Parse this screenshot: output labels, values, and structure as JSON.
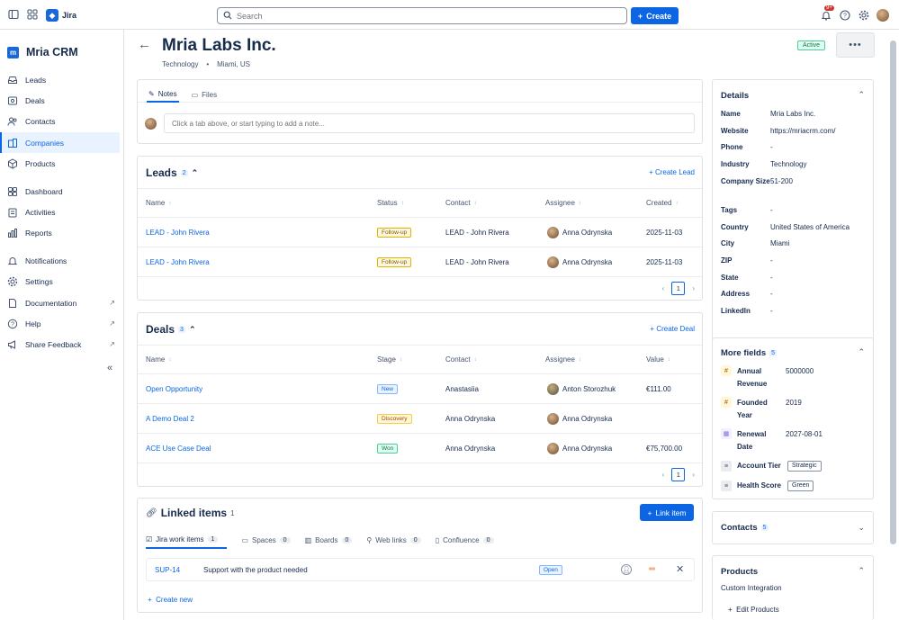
{
  "topbar": {
    "app_name": "Jira",
    "search_placeholder": "Search",
    "create_label": "Create",
    "notif_count": "9+"
  },
  "sidebar": {
    "brand": "Mria CRM",
    "items": [
      {
        "label": "Leads",
        "icon": "inbox-icon"
      },
      {
        "label": "Deals",
        "icon": "deals-icon"
      },
      {
        "label": "Contacts",
        "icon": "contacts-icon"
      },
      {
        "label": "Companies",
        "icon": "companies-icon"
      },
      {
        "label": "Products",
        "icon": "box-icon"
      },
      {
        "label": "Dashboard",
        "icon": "dashboard-icon"
      },
      {
        "label": "Activities",
        "icon": "activities-icon"
      },
      {
        "label": "Reports",
        "icon": "reports-icon"
      },
      {
        "label": "Notifications",
        "icon": "bell-icon"
      },
      {
        "label": "Settings",
        "icon": "gear-icon"
      },
      {
        "label": "Documentation",
        "icon": "doc-icon"
      },
      {
        "label": "Help",
        "icon": "help-icon"
      },
      {
        "label": "Share Feedback",
        "icon": "megaphone-icon"
      }
    ],
    "active": "Companies"
  },
  "header": {
    "title": "Mria Labs Inc.",
    "industry": "Technology",
    "separator": "•",
    "location": "Miami, US",
    "status": "Active"
  },
  "notes": {
    "tabs": [
      "Notes",
      "Files"
    ],
    "placeholder": "Click a tab above, or start typing to add a note..."
  },
  "leads": {
    "title": "Leads",
    "count": "2",
    "action": "Create Lead",
    "columns": [
      "Name",
      "Status",
      "Contact",
      "Assignee",
      "Created"
    ],
    "rows": [
      {
        "name": "LEAD - John Rivera",
        "status": "Follow-up",
        "contact": "LEAD - John Rivera",
        "assignee": "Anna Odrynska",
        "created": "2025-11-03"
      },
      {
        "name": "LEAD - John Rivera",
        "status": "Follow-up",
        "contact": "LEAD - John Rivera",
        "assignee": "Anna Odrynska",
        "created": "2025-11-03"
      }
    ],
    "page": "1"
  },
  "deals": {
    "title": "Deals",
    "count": "3",
    "action": "Create Deal",
    "columns": [
      "Name",
      "Stage",
      "Contact",
      "Assignee",
      "Value"
    ],
    "rows": [
      {
        "name": "Open Opportunity",
        "stage": "New",
        "contact": "Anastasiia",
        "assignee": "Anton Storozhuk",
        "value": "€111.00"
      },
      {
        "name": "A Demo Deal 2",
        "stage": "Discovery",
        "contact": "Anna Odrynska",
        "assignee": "Anna Odrynska",
        "value": ""
      },
      {
        "name": "ACE Use Case Deal",
        "stage": "Won",
        "contact": "Anna Odrynska",
        "assignee": "Anna Odrynska",
        "value": "€75,700.00"
      }
    ],
    "page": "1"
  },
  "linked": {
    "title": "Linked items",
    "count": "1",
    "action": "Link item",
    "tabs": [
      {
        "label": "Jira work items",
        "count": "1"
      },
      {
        "label": "Spaces",
        "count": "0"
      },
      {
        "label": "Boards",
        "count": "0"
      },
      {
        "label": "Web links",
        "count": "0"
      },
      {
        "label": "Confluence",
        "count": "0"
      }
    ],
    "item": {
      "key": "SUP-14",
      "summary": "Support with the product needed",
      "status": "Open"
    },
    "create_new": "Create new"
  },
  "details": {
    "title": "Details",
    "rows": [
      {
        "k": "Name",
        "v": "Mria Labs Inc."
      },
      {
        "k": "Website",
        "v": "https://mriacrm.com/"
      },
      {
        "k": "Phone",
        "v": "-"
      },
      {
        "k": "Industry",
        "v": "Technology"
      },
      {
        "k": "Company Size",
        "v": "51-200"
      },
      {
        "k": "Tags",
        "v": "-"
      },
      {
        "k": "Country",
        "v": "United States of America"
      },
      {
        "k": "City",
        "v": "Miami"
      },
      {
        "k": "ZIP",
        "v": "-"
      },
      {
        "k": "State",
        "v": "-"
      },
      {
        "k": "Address",
        "v": "-"
      },
      {
        "k": "LinkedIn",
        "v": "-"
      }
    ]
  },
  "more_fields": {
    "title": "More fields",
    "count": "5",
    "rows": [
      {
        "k": "Annual Revenue",
        "v": "5000000",
        "icon": "#"
      },
      {
        "k": "Founded Year",
        "v": "2019",
        "icon": "#"
      },
      {
        "k": "Renewal Date",
        "v": "2027-08-01",
        "icon": "calendar"
      },
      {
        "k": "Account Tier",
        "v": "Strategic",
        "icon": "list"
      },
      {
        "k": "Health Score",
        "v": "Green",
        "icon": "list"
      }
    ]
  },
  "contacts": {
    "title": "Contacts",
    "count": "5"
  },
  "products": {
    "title": "Products",
    "item": "Custom Integration",
    "action": "Edit Products"
  }
}
